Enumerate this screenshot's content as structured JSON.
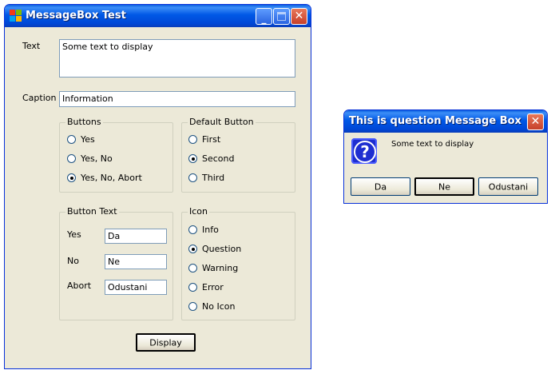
{
  "main_window": {
    "title": "MessageBox Test",
    "text_label": "Text",
    "text_value": "Some text to display",
    "caption_label": "Caption",
    "caption_value": "Information",
    "buttons_group": {
      "title": "Buttons",
      "options": [
        "Yes",
        "Yes, No",
        "Yes, No, Abort"
      ],
      "selected": "Yes, No, Abort"
    },
    "default_button_group": {
      "title": "Default Button",
      "options": [
        "First",
        "Second",
        "Third"
      ],
      "selected": "Second"
    },
    "button_text_group": {
      "title": "Button Text",
      "yes_label": "Yes",
      "yes_value": "Da",
      "no_label": "No",
      "no_value": "Ne",
      "abort_label": "Abort",
      "abort_value": "Odustani"
    },
    "icon_group": {
      "title": "Icon",
      "options": [
        "Info",
        "Question",
        "Warning",
        "Error",
        "No Icon"
      ],
      "selected": "Question"
    },
    "display_button": "Display"
  },
  "message_box": {
    "title": "This is question Message Box",
    "message": "Some text to display",
    "icon": "question-icon",
    "buttons": [
      "Da",
      "Ne",
      "Odustani"
    ]
  },
  "colors": {
    "title_bar": "#0054e3",
    "window_bg": "#ece9d8",
    "close_button": "#d8553a"
  }
}
